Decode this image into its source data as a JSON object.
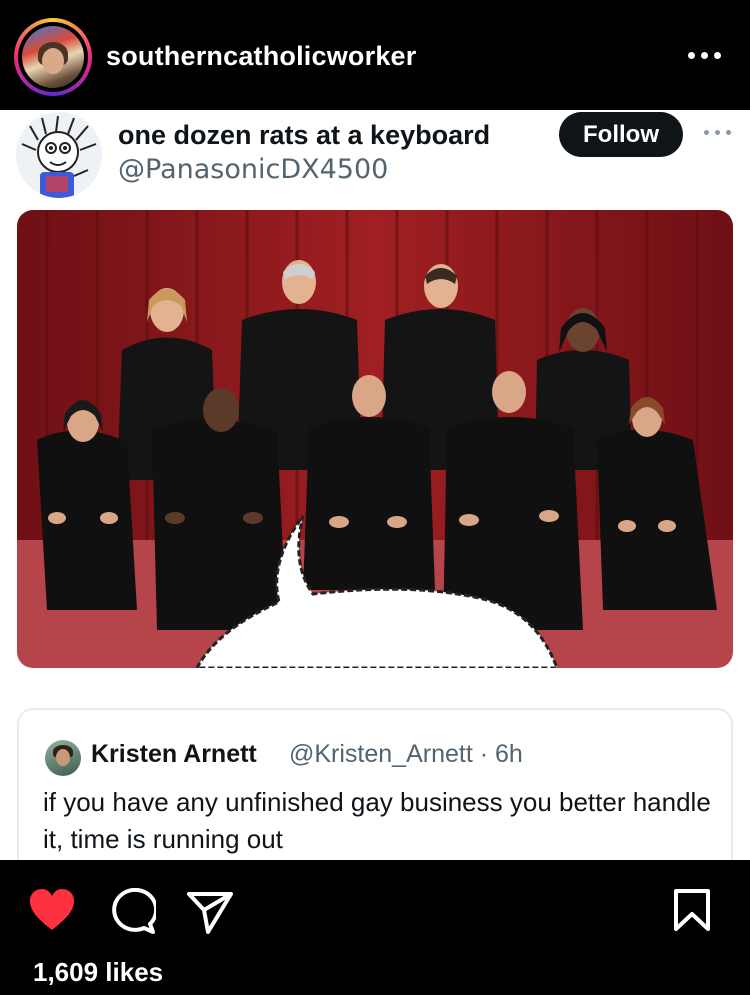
{
  "header": {
    "username": "southerncatholicworker",
    "avatar_icon": "profile-avatar",
    "more_icon": "more-horizontal-icon"
  },
  "tweet": {
    "display_name": "one dozen rats at a keyboard",
    "handle": "@PanasonicDX4500",
    "follow_label": "Follow",
    "more_icon": "more-horizontal-icon",
    "photo_icon": "group-photo"
  },
  "quote": {
    "display_name": "Kristen Arnett",
    "handle_time": "@Kristen_Arnett · 6h",
    "text": "if you have any unfinished gay business you better handle it, time is running out"
  },
  "actions": {
    "like_icon": "heart-icon",
    "comment_icon": "comment-icon",
    "share_icon": "send-icon",
    "save_icon": "bookmark-icon",
    "liked": true,
    "like_color": "#ff3040",
    "likes_text": "1,609 likes"
  },
  "colors": {
    "background": "#000000",
    "follow_button": "#0f1419",
    "curtain": "#8f1a1e"
  }
}
